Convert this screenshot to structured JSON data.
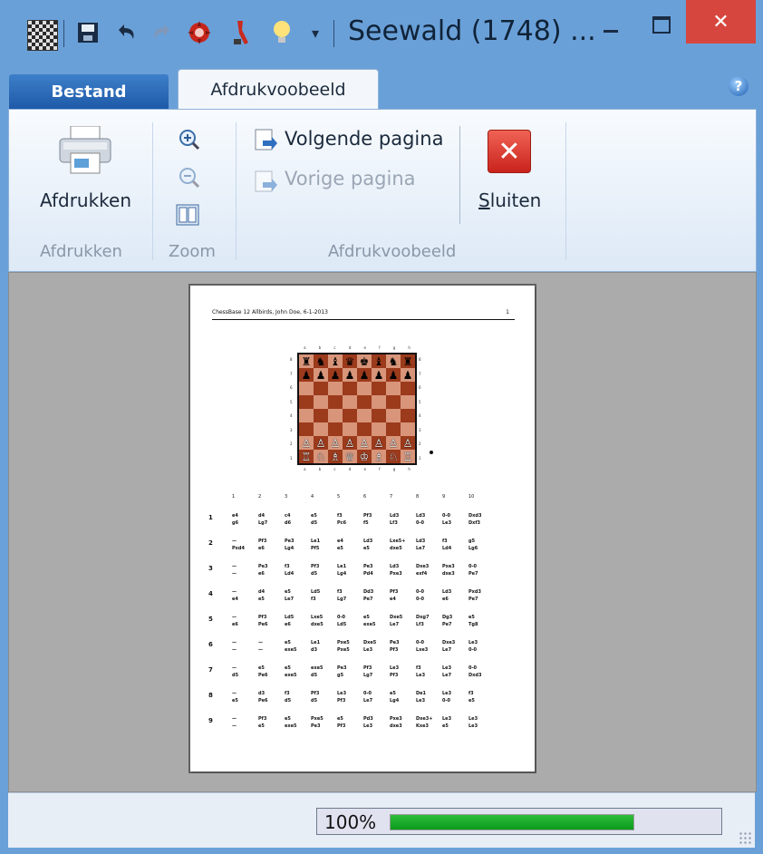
{
  "window": {
    "title": "Seewald (1748) ...",
    "close_glyph": "✕"
  },
  "quick_access": {
    "icons": [
      "app-board-icon",
      "save-icon",
      "undo-icon",
      "redo-icon",
      "engine-icon",
      "tools-icon",
      "idea-icon",
      "customize-dropdown-icon"
    ]
  },
  "ribbon": {
    "tabs": {
      "file": "Bestand",
      "preview": "Afdrukvoobeeld"
    },
    "help_glyph": "?",
    "print": {
      "button_label": "Afdrukken",
      "group_label": "Afdrukken"
    },
    "zoom": {
      "group_label": "Zoom"
    },
    "navigation": {
      "next_label": "Volgende pagina",
      "prev_label": "Vorige pagina",
      "group_label": "Afdrukvoobeeld"
    },
    "close": {
      "label": "Sluiten",
      "mnemonic": "S",
      "rest": "luiten",
      "glyph": "✕"
    }
  },
  "page": {
    "header": "ChessBase 12 Allbirds, John Doe, 6-1-2013",
    "number": "1",
    "board": {
      "ranks": [
        "8",
        "7",
        "6",
        "5",
        "4",
        "3",
        "2",
        "1"
      ],
      "files": [
        "a",
        "b",
        "c",
        "d",
        "e",
        "f",
        "g",
        "h"
      ],
      "rows": [
        [
          "♜",
          "♞",
          "♝",
          "♛",
          "♚",
          "♝",
          "♞",
          "♜"
        ],
        [
          "♟",
          "♟",
          "♟",
          "♟",
          "♟",
          "♟",
          "♟",
          "♟"
        ],
        [
          "",
          "",
          "",
          "",
          "",
          "",
          "",
          ""
        ],
        [
          "",
          "",
          "",
          "",
          "",
          "",
          "",
          ""
        ],
        [
          "",
          "",
          "",
          "",
          "",
          "",
          "",
          ""
        ],
        [
          "",
          "",
          "",
          "",
          "",
          "",
          "",
          ""
        ],
        [
          "♙",
          "♙",
          "♙",
          "♙",
          "♙",
          "♙",
          "♙",
          "♙"
        ],
        [
          "♖",
          "♘",
          "♗",
          "♕",
          "♔",
          "♗",
          "♘",
          "♖"
        ]
      ]
    },
    "move_table": {
      "columns": [
        "1",
        "2",
        "3",
        "4",
        "5",
        "6",
        "7",
        "8",
        "9",
        "10"
      ],
      "rows": [
        {
          "n": "1",
          "cells": [
            [
              "e4",
              "g6"
            ],
            [
              "d4",
              "Lg7"
            ],
            [
              "c4",
              "d6"
            ],
            [
              "e5",
              "d5"
            ],
            [
              "f3",
              "Pc6"
            ],
            [
              "Pf3",
              "f5"
            ],
            [
              "Ld3",
              "Lf3"
            ],
            [
              "Ld3",
              "0-0"
            ],
            [
              "0-0",
              "Le3"
            ],
            [
              "Dxd3",
              "Dxf3"
            ]
          ]
        },
        {
          "n": "2",
          "cells": [
            [
              "—",
              "Pxd4"
            ],
            [
              "Pf3",
              "e6"
            ],
            [
              "Pe3",
              "Lg4"
            ],
            [
              "Le1",
              "Pf5"
            ],
            [
              "e4",
              "e5"
            ],
            [
              "Ld3",
              "e5"
            ],
            [
              "Lxe5+",
              "dxe5"
            ],
            [
              "Ld3",
              "Le7"
            ],
            [
              "f3",
              "Ld4"
            ],
            [
              "g5",
              "Lg6"
            ]
          ]
        },
        {
          "n": "3",
          "cells": [
            [
              "—",
              "—"
            ],
            [
              "Pe3",
              "e6"
            ],
            [
              "f3",
              "Ld4"
            ],
            [
              "Pf3",
              "d5"
            ],
            [
              "Le1",
              "Lg4"
            ],
            [
              "Pe3",
              "Pd4"
            ],
            [
              "Ld3",
              "Pxe3"
            ],
            [
              "Dxe3",
              "exf4"
            ],
            [
              "Pxe3",
              "dxe3"
            ],
            [
              "0-0",
              "Pe7"
            ]
          ]
        },
        {
          "n": "4",
          "cells": [
            [
              "—",
              "e4"
            ],
            [
              "d4",
              "e5"
            ],
            [
              "e5",
              "Le7"
            ],
            [
              "Ld5",
              "f3"
            ],
            [
              "f3",
              "Lg7"
            ],
            [
              "Dd3",
              "Pe7"
            ],
            [
              "Pf3",
              "e4"
            ],
            [
              "0-0",
              "0-0"
            ],
            [
              "Ld3",
              "e6"
            ],
            [
              "Pxd3",
              "Pe7"
            ]
          ]
        },
        {
          "n": "5",
          "cells": [
            [
              "—",
              "e6"
            ],
            [
              "Pf3",
              "Pe6"
            ],
            [
              "Ld5",
              "e6"
            ],
            [
              "Lxe5",
              "dxe5"
            ],
            [
              "0-0",
              "Ld5"
            ],
            [
              "e5",
              "exe5"
            ],
            [
              "Dxe5",
              "Le7"
            ],
            [
              "Dxg7",
              "Lf3"
            ],
            [
              "Dg3",
              "Pe7"
            ],
            [
              "e5",
              "Tg8"
            ]
          ]
        },
        {
          "n": "6",
          "cells": [
            [
              "—",
              "—"
            ],
            [
              "—",
              "—"
            ],
            [
              "e5",
              "exe5"
            ],
            [
              "Le1",
              "d3"
            ],
            [
              "Pxe5",
              "Pxe5"
            ],
            [
              "Dxe5",
              "Le3"
            ],
            [
              "Pe3",
              "Pf3"
            ],
            [
              "0-0",
              "Lxe3"
            ],
            [
              "Dxe3",
              "Le7"
            ],
            [
              "Le3",
              "0-0"
            ]
          ]
        },
        {
          "n": "7",
          "cells": [
            [
              "—",
              "d5"
            ],
            [
              "e5",
              "Pe6"
            ],
            [
              "e5",
              "exe5"
            ],
            [
              "exe5",
              "d5"
            ],
            [
              "Pe3",
              "g5"
            ],
            [
              "Pf3",
              "Lg7"
            ],
            [
              "Le3",
              "Pf3"
            ],
            [
              "f3",
              "Le3"
            ],
            [
              "Le3",
              "Le7"
            ],
            [
              "0-0",
              "Dxd3"
            ]
          ]
        },
        {
          "n": "8",
          "cells": [
            [
              "—",
              "e5"
            ],
            [
              "d3",
              "Pe6"
            ],
            [
              "f3",
              "d5"
            ],
            [
              "Pf3",
              "d5"
            ],
            [
              "Le3",
              "Pf3"
            ],
            [
              "0-0",
              "Le7"
            ],
            [
              "e5",
              "Lg4"
            ],
            [
              "De1",
              "Le3"
            ],
            [
              "Le3",
              "0-0"
            ],
            [
              "f3",
              "e5"
            ]
          ]
        },
        {
          "n": "9",
          "cells": [
            [
              "—",
              "—"
            ],
            [
              "Pf3",
              "e5"
            ],
            [
              "e5",
              "exe5"
            ],
            [
              "Pxe5",
              "Pe3"
            ],
            [
              "e5",
              "Pf3"
            ],
            [
              "Pd3",
              "Le3"
            ],
            [
              "Pxe3",
              "dxe3"
            ],
            [
              "Dxe3+",
              "Kxe3"
            ],
            [
              "Le3",
              "e5"
            ],
            [
              "Le3",
              "Le3"
            ]
          ]
        }
      ]
    }
  },
  "status": {
    "zoom_text": "100%",
    "progress": 1.0
  },
  "colors": {
    "title_bar": "#6aa0d8",
    "close_button": "#d7463e",
    "file_tab": "#1e5aa8",
    "progress_fill": "#16a82a",
    "board_light": "#d8957a",
    "board_dark": "#9c3a1c"
  }
}
